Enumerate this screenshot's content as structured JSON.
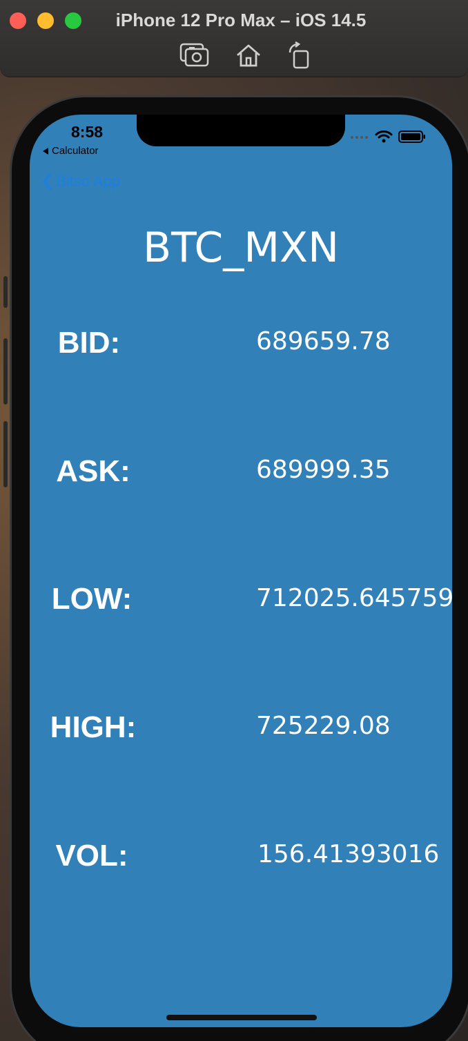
{
  "simulator": {
    "title": "iPhone 12 Pro Max – iOS 14.5",
    "tools": [
      "screenshot-icon",
      "home-icon",
      "rotate-icon"
    ]
  },
  "status_bar": {
    "time": "8:58",
    "back_app": "Calculator"
  },
  "nav": {
    "back_label": "Bitso App"
  },
  "ticker": {
    "pair": "BTC_MXN",
    "rows": [
      {
        "label": "BID:",
        "value": "689659.78"
      },
      {
        "label": "ASK:",
        "value": "689999.35"
      },
      {
        "label": "LOW:",
        "value": "712025.645759"
      },
      {
        "label": "HIGH:",
        "value": "725229.08"
      },
      {
        "label": "VOL:",
        "value": "156.41393016"
      }
    ]
  },
  "colors": {
    "screen_background": "#3180b8",
    "nav_tint": "#1e7fe0",
    "text": "#ffffff"
  }
}
